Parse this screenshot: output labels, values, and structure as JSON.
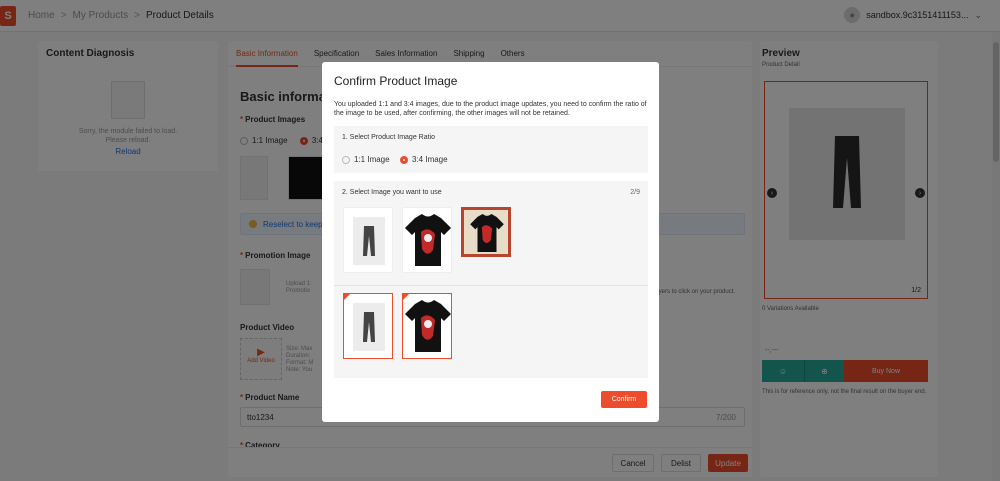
{
  "breadcrumb": {
    "home": "Home",
    "products": "My Products",
    "current": "Product Details",
    "sep": ">"
  },
  "user": {
    "name": "sandbox.9c3151411153..."
  },
  "diagnosis": {
    "title": "Content Diagnosis",
    "msg1": "Sorry, the module failed to load.",
    "msg2": "Please reload.",
    "reload": "Reload"
  },
  "tabs": [
    "Basic Information",
    "Specification",
    "Sales Information",
    "Shipping",
    "Others"
  ],
  "main": {
    "section_title": "Basic information",
    "product_images": "Product Images",
    "opt_11": "1:1 Image",
    "opt_34": "3:4",
    "notice": "Reselect to keep th",
    "promotion_image": "Promotion Image",
    "promo_notes": [
      "Upload 1:",
      "Promotio"
    ],
    "promo_tail": "buyers to click on your product.",
    "product_video": "Product Video",
    "add_video": "Add Video",
    "video_notes": [
      "Size: Max",
      "Duration:",
      "Format: M",
      "Note: You"
    ],
    "product_name": "Product Name",
    "product_name_value": "tto1234",
    "name_count": "7/200",
    "category": "Category",
    "cancel": "Cancel",
    "delist": "Delist",
    "update": "Update"
  },
  "preview": {
    "title": "Preview",
    "sub": "Product Detail",
    "count": "1/2",
    "variations": "0 Variations Available",
    "price": "--,---",
    "buy_now": "Buy Now",
    "note": "This is for reference only, not the final result on the buyer end."
  },
  "modal": {
    "title": "Confirm Product Image",
    "desc": "You uploaded 1:1 and 3:4 images, due to the product image updates, you need to confirm the ratio of the image to be used, after confirming, the other images will not be retained.",
    "step1": "1. Select Product Image Ratio",
    "ratio_11": "1:1 Image",
    "ratio_34": "3:4 Image",
    "step2": "2. Select Image you want to use",
    "page_count": "2/9",
    "confirm": "Confirm"
  },
  "colors": {
    "accent": "#ee4d2d",
    "teal": "#26aa99",
    "link": "#2673dd"
  }
}
